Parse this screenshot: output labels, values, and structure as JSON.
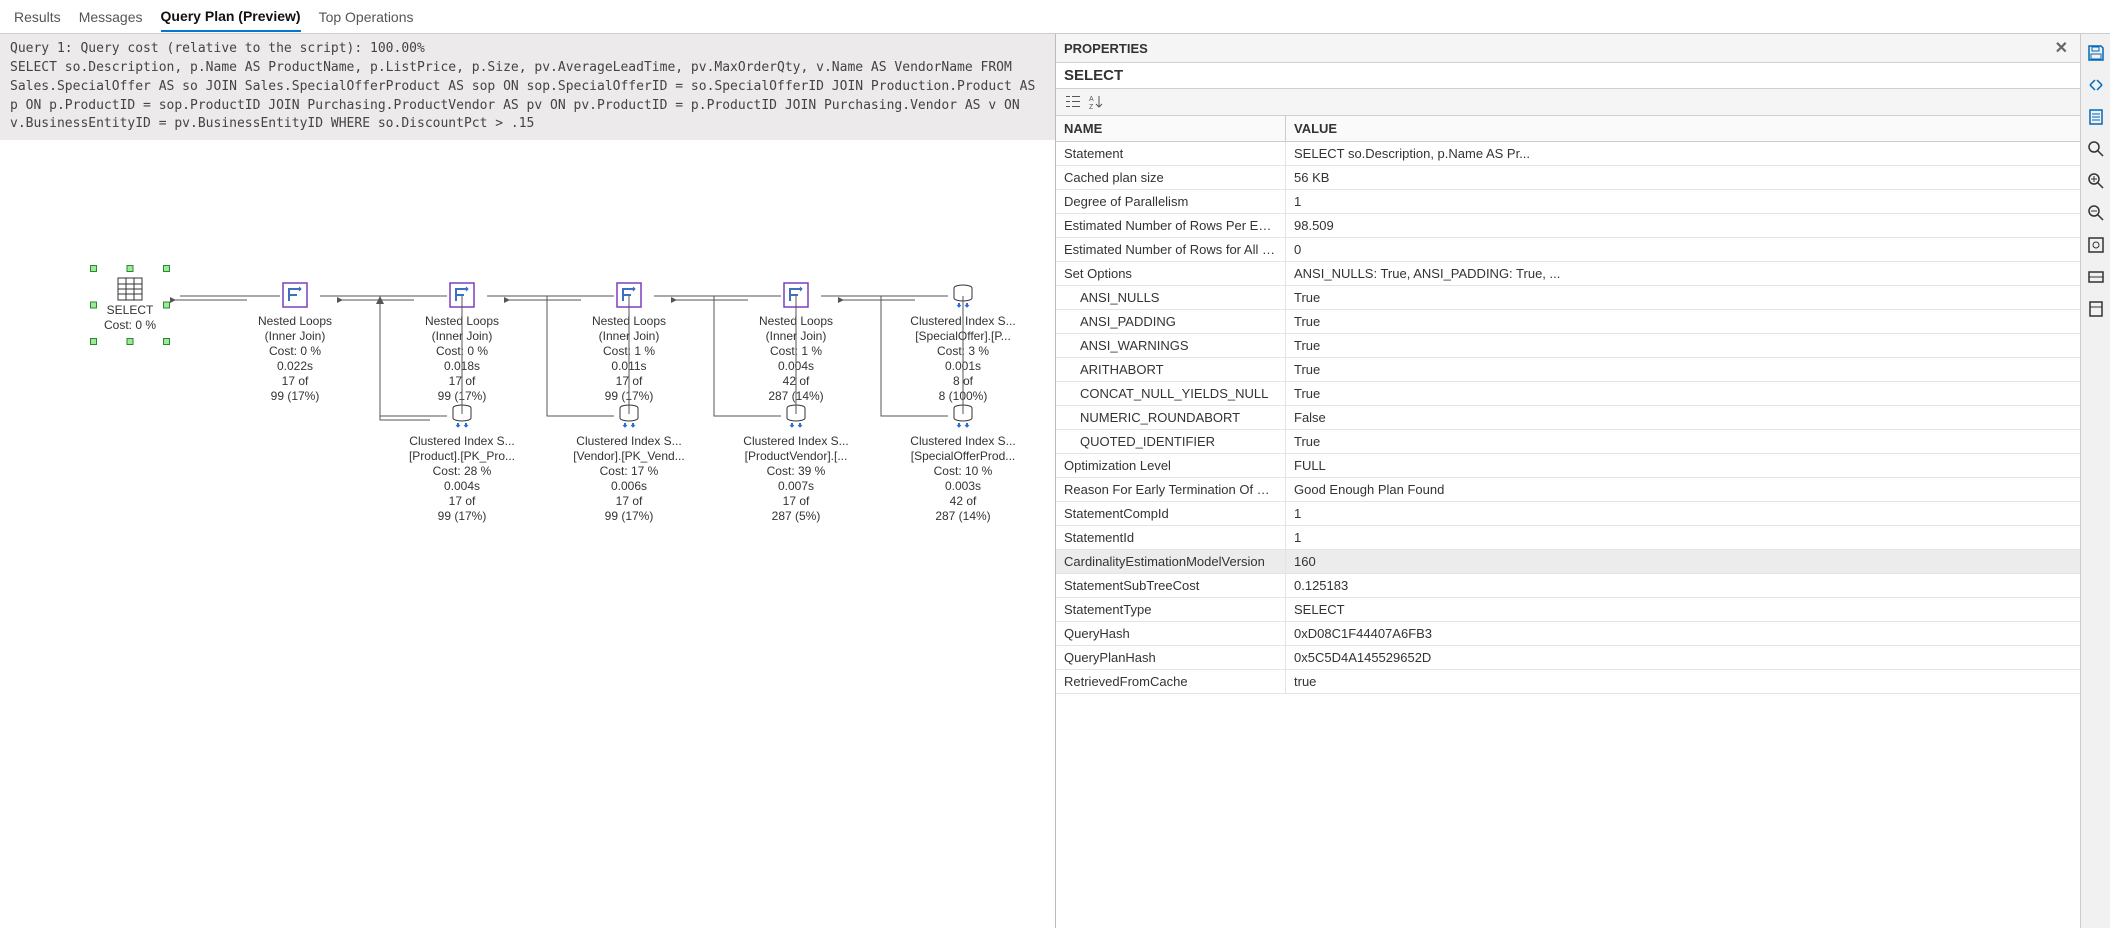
{
  "tabs": {
    "results": "Results",
    "messages": "Messages",
    "query_plan": "Query Plan (Preview)",
    "top_ops": "Top Operations"
  },
  "query_header": "Query 1: Query cost (relative to the script): 100.00%\nSELECT so.Description, p.Name AS ProductName, p.ListPrice, p.Size, pv.AverageLeadTime, pv.MaxOrderQty, v.Name AS VendorName FROM Sales.SpecialOffer AS so JOIN Sales.SpecialOfferProduct AS sop ON sop.SpecialOfferID = so.SpecialOfferID JOIN Production.Product AS p ON p.ProductID = sop.ProductID JOIN Purchasing.ProductVendor AS pv ON pv.ProductID = p.ProductID JOIN Purchasing.Vendor AS v ON v.BusinessEntityID = pv.BusinessEntityID WHERE so.DiscountPct > .15",
  "select_node": {
    "label": "SELECT",
    "cost": "Cost: 0 %"
  },
  "top_nodes": [
    {
      "title": "Nested Loops",
      "sub": "(Inner Join)",
      "cost": "Cost: 0 %",
      "time": "0.022s",
      "rows1": "17 of",
      "rows2": "99 (17%)"
    },
    {
      "title": "Nested Loops",
      "sub": "(Inner Join)",
      "cost": "Cost: 0 %",
      "time": "0.018s",
      "rows1": "17 of",
      "rows2": "99 (17%)"
    },
    {
      "title": "Nested Loops",
      "sub": "(Inner Join)",
      "cost": "Cost: 1 %",
      "time": "0.011s",
      "rows1": "17 of",
      "rows2": "99 (17%)"
    },
    {
      "title": "Nested Loops",
      "sub": "(Inner Join)",
      "cost": "Cost: 1 %",
      "time": "0.004s",
      "rows1": "42 of",
      "rows2": "287 (14%)"
    },
    {
      "title": "Clustered Index S...",
      "sub": "[SpecialOffer].[P...",
      "cost": "Cost: 3 %",
      "time": "0.001s",
      "rows1": "8 of",
      "rows2": "8 (100%)"
    }
  ],
  "bottom_nodes": [
    {
      "title": "Clustered Index S...",
      "sub": "[Product].[PK_Pro...",
      "cost": "Cost: 28 %",
      "time": "0.004s",
      "rows1": "17 of",
      "rows2": "99 (17%)"
    },
    {
      "title": "Clustered Index S...",
      "sub": "[Vendor].[PK_Vend...",
      "cost": "Cost: 17 %",
      "time": "0.006s",
      "rows1": "17 of",
      "rows2": "99 (17%)"
    },
    {
      "title": "Clustered Index S...",
      "sub": "[ProductVendor].[...",
      "cost": "Cost: 39 %",
      "time": "0.007s",
      "rows1": "17 of",
      "rows2": "287 (5%)"
    },
    {
      "title": "Clustered Index S...",
      "sub": "[SpecialOfferProd...",
      "cost": "Cost: 10 %",
      "time": "0.003s",
      "rows1": "42 of",
      "rows2": "287 (14%)"
    }
  ],
  "props": {
    "title": "PROPERTIES",
    "subtitle": "SELECT",
    "col_name": "NAME",
    "col_value": "VALUE",
    "rows": [
      {
        "name": "Statement",
        "value": "SELECT so.Description,        p.Name AS Pr..."
      },
      {
        "name": "Cached plan size",
        "value": "56 KB"
      },
      {
        "name": "Degree of Parallelism",
        "value": "1"
      },
      {
        "name": "Estimated Number of Rows Per Execution",
        "value": "98.509"
      },
      {
        "name": "Estimated Number of Rows for All Executi...",
        "value": "0"
      },
      {
        "name": "Set Options",
        "value": "ANSI_NULLS: True, ANSI_PADDING: True, ..."
      },
      {
        "name": "ANSI_NULLS",
        "value": "True",
        "sub": true
      },
      {
        "name": "ANSI_PADDING",
        "value": "True",
        "sub": true
      },
      {
        "name": "ANSI_WARNINGS",
        "value": "True",
        "sub": true
      },
      {
        "name": "ARITHABORT",
        "value": "True",
        "sub": true
      },
      {
        "name": "CONCAT_NULL_YIELDS_NULL",
        "value": "True",
        "sub": true
      },
      {
        "name": "NUMERIC_ROUNDABORT",
        "value": "False",
        "sub": true
      },
      {
        "name": "QUOTED_IDENTIFIER",
        "value": "True",
        "sub": true
      },
      {
        "name": "Optimization Level",
        "value": "FULL"
      },
      {
        "name": "Reason For Early Termination Of Stateme...",
        "value": "Good Enough Plan Found"
      },
      {
        "name": "StatementCompId",
        "value": "1"
      },
      {
        "name": "StatementId",
        "value": "1"
      },
      {
        "name": "CardinalityEstimationModelVersion",
        "value": "160",
        "highlight": true
      },
      {
        "name": "StatementSubTreeCost",
        "value": "0.125183"
      },
      {
        "name": "StatementType",
        "value": "SELECT"
      },
      {
        "name": "QueryHash",
        "value": "0xD08C1F44407A6FB3"
      },
      {
        "name": "QueryPlanHash",
        "value": "0x5C5D4A145529652D"
      },
      {
        "name": "RetrievedFromCache",
        "value": "true"
      }
    ]
  }
}
